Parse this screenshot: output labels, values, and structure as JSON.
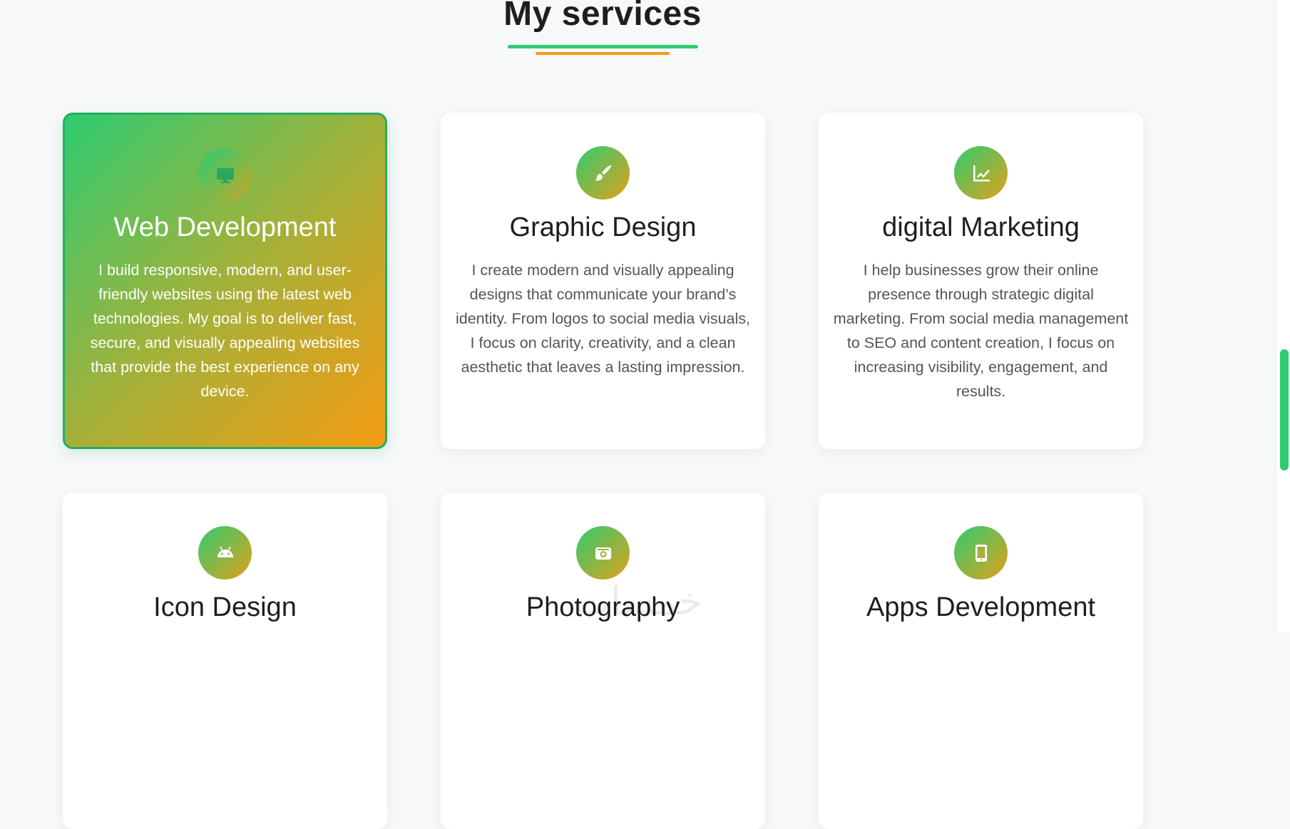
{
  "section": {
    "title": "My services"
  },
  "colors": {
    "accent_green": "#2ecc71",
    "accent_orange": "#f39c12",
    "background": "#f7f8fa"
  },
  "services": [
    {
      "title": "Web Development",
      "icon": "monitor-icon",
      "description": "I build responsive, modern, and user-friendly websites using the latest web technologies. My goal is to deliver fast, secure, and visually appealing websites that provide the best experience on any device.",
      "active": true
    },
    {
      "title": "Graphic Design",
      "icon": "paint-brush-icon",
      "description": "I create modern and visually appealing designs that communicate your brand’s identity. From logos to social media visuals, I focus on clarity, creativity, and a clean aesthetic that leaves a lasting impression.",
      "active": false
    },
    {
      "title": "digital Marketing",
      "icon": "line-chart-icon",
      "description": "I help businesses grow their online presence through strategic digital marketing. From social media management to SEO and content creation, I focus on increasing visibility, engagement, and results.",
      "active": false
    },
    {
      "title": "Icon Design",
      "icon": "android-icon",
      "description": "",
      "active": false
    },
    {
      "title": "Photography",
      "icon": "camera-icon",
      "description": "",
      "active": false
    },
    {
      "title": "Apps Development",
      "icon": "tablet-icon",
      "description": "",
      "active": false
    }
  ],
  "watermark": {
    "text": "خمسات"
  }
}
